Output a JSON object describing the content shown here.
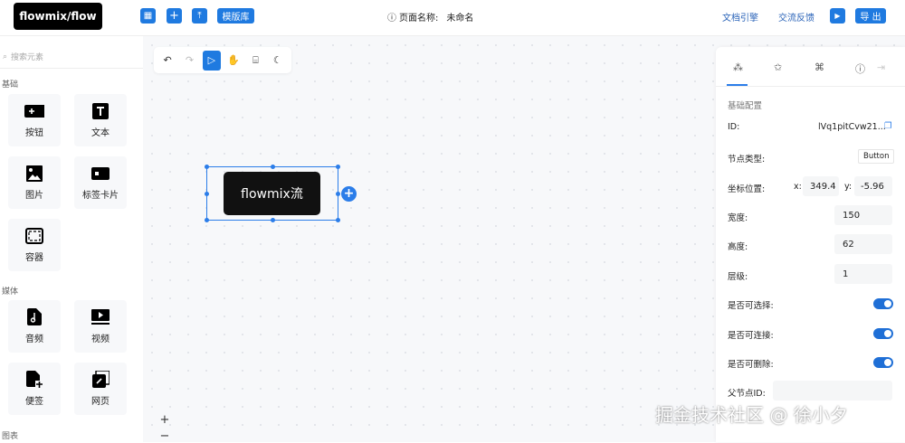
{
  "header": {
    "logo": "flowmix/flow",
    "template_lib": "模版库",
    "page_name_label": "页面名称:",
    "page_name": "未命名",
    "docs": "文档引擎",
    "feedback": "交流反馈",
    "export": "导 出",
    "info_icon": "ⓘ"
  },
  "sidebar": {
    "search_placeholder": "搜索元素",
    "sections": [
      {
        "title": "基础",
        "items": [
          {
            "label": "按钮",
            "icon": "button-icon"
          },
          {
            "label": "文本",
            "icon": "text-icon"
          },
          {
            "label": "图片",
            "icon": "image-icon"
          },
          {
            "label": "标签卡片",
            "icon": "tag-card-icon"
          },
          {
            "label": "容器",
            "icon": "container-icon"
          }
        ]
      },
      {
        "title": "媒体",
        "items": [
          {
            "label": "音频",
            "icon": "audio-icon"
          },
          {
            "label": "视频",
            "icon": "video-icon"
          },
          {
            "label": "便签",
            "icon": "note-icon"
          },
          {
            "label": "网页",
            "icon": "webpage-icon"
          }
        ]
      },
      {
        "title": "图表",
        "items": []
      }
    ]
  },
  "canvas": {
    "node_text": "flowmix流",
    "zoom_in": "+",
    "zoom_out": "−"
  },
  "panel": {
    "section_title": "基础配置",
    "id_label": "ID:",
    "id_value": "lVq1pitCvw21...",
    "type_label": "节点类型:",
    "type_value": "Button",
    "pos_label": "坐标位置:",
    "x_label": "x:",
    "x_value": "349.4",
    "y_label": "y:",
    "y_value": "-5.96",
    "width_label": "宽度:",
    "width_value": "150",
    "height_label": "高度:",
    "height_value": "62",
    "z_label": "层级:",
    "z_value": "1",
    "selectable_label": "是否可选择:",
    "selectable": true,
    "connectable_label": "是否可连接:",
    "connectable": true,
    "deletable_label": "是否可删除:",
    "deletable": true,
    "parent_label": "父节点ID:",
    "parent_value": ""
  },
  "watermark": "掘金技术社区 @ 徐小夕",
  "colors": {
    "accent": "#1f7ae0",
    "node": "#111111"
  }
}
